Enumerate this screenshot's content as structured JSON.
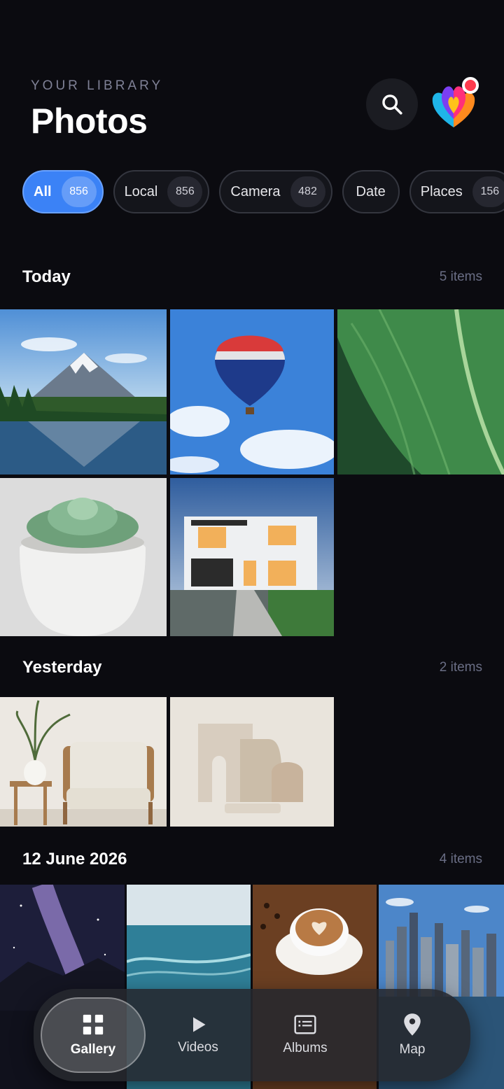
{
  "header": {
    "eyebrow": "YOUR LIBRARY",
    "title": "Photos"
  },
  "filters": [
    {
      "label": "All",
      "count": "856",
      "active": true
    },
    {
      "label": "Local",
      "count": "856"
    },
    {
      "label": "Camera",
      "count": "482"
    },
    {
      "label": "Date",
      "count": ""
    },
    {
      "label": "Places",
      "count": "156"
    }
  ],
  "sections": [
    {
      "title": "Today",
      "count": "5 items"
    },
    {
      "title": "Yesterday",
      "count": "2 items"
    },
    {
      "title": "12 June 2026",
      "count": "4 items"
    }
  ],
  "photos": {
    "today": [
      "mountain-lake",
      "hot-air-balloon",
      "green-leaf",
      "succulent-pot",
      "modern-house"
    ],
    "yesterday": [
      "armchair-interior",
      "arch-shapes"
    ],
    "june12": [
      "milky-way",
      "ocean-waves",
      "latte-art",
      "city-skyline"
    ]
  },
  "nav": {
    "gallery": "Gallery",
    "videos": "Videos",
    "albums": "Albums",
    "map": "Map"
  },
  "colors": {
    "accent": "#3b82f6",
    "background": "#0b0b10",
    "notification": "#ff3b4e"
  },
  "icons": [
    "search-icon",
    "app-logo-icon",
    "grid-icon",
    "play-icon",
    "albums-icon",
    "map-pin-icon"
  ]
}
